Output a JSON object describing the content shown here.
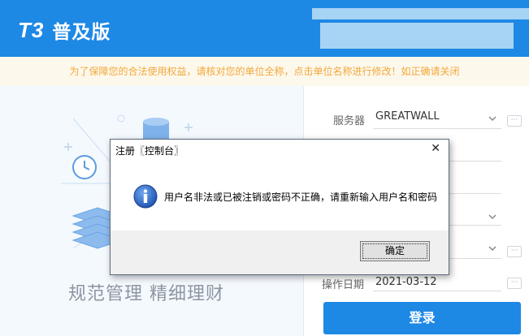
{
  "header": {
    "logo_mark": "T3",
    "product_name": "普及版",
    "accent_color": "#1e88e5"
  },
  "notice": {
    "text": "为了保障您的合法使用权益，请核对您的单位全称，点击单位名称进行修改！如正确请关闭"
  },
  "illustration": {
    "slogan": "规范管理   精细理财"
  },
  "login": {
    "server_label": "服务器",
    "server_value": "GREATWALL",
    "date_label": "操作日期",
    "date_value": "2021-03-12",
    "login_button": "登录"
  },
  "dialog": {
    "title": "注册〖控制台〗",
    "close_glyph": "✕",
    "icon": "info-icon",
    "message": "用户名非法或已被注销或密码不正确，请重新输入用户名和密码",
    "ok_label": "确定"
  }
}
